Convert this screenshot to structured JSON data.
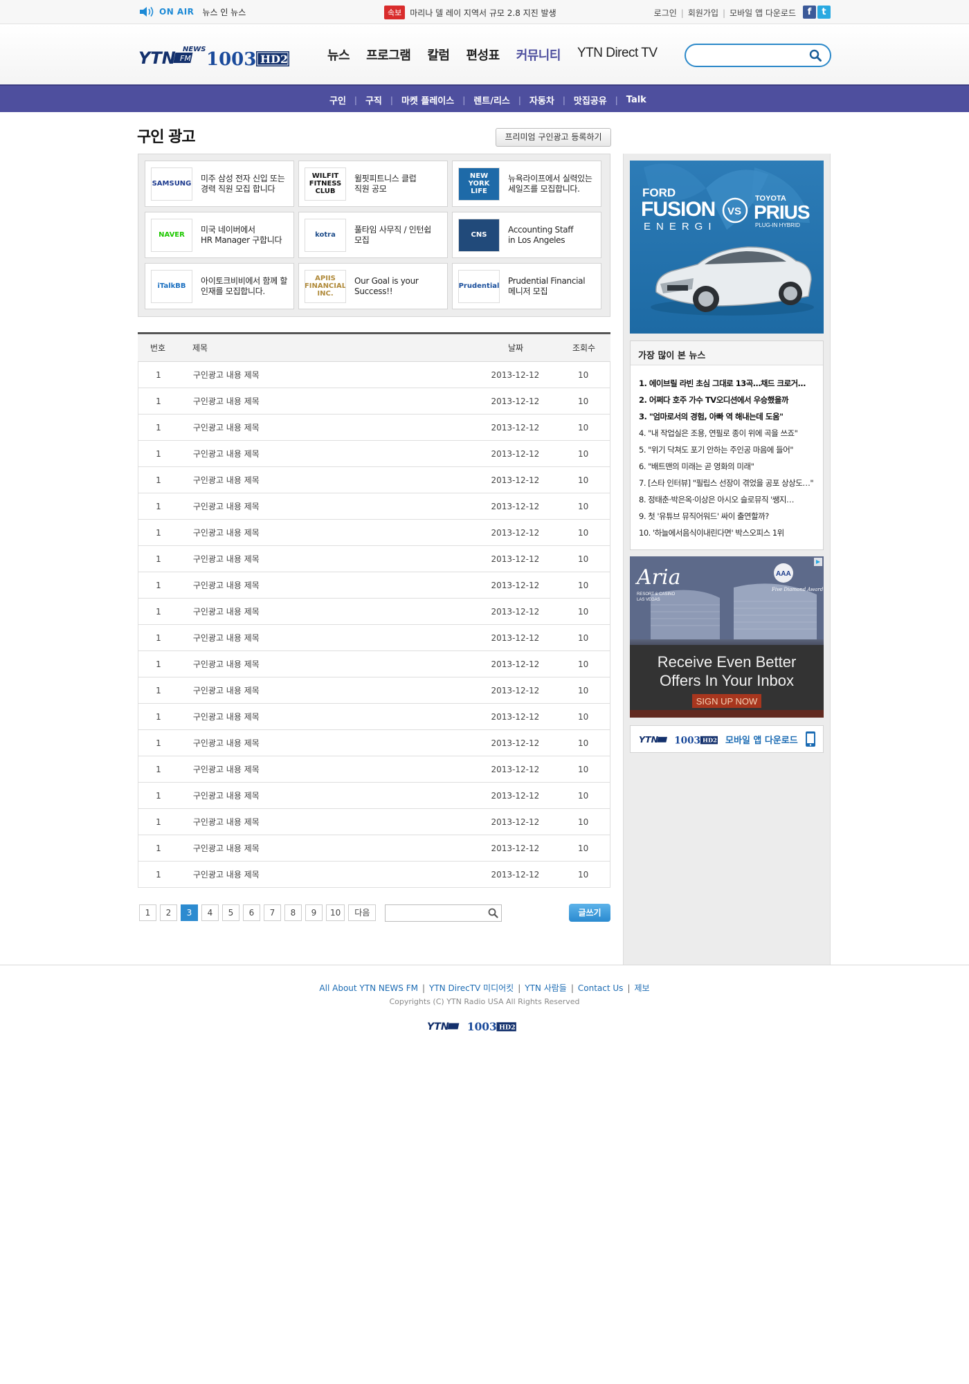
{
  "topbar": {
    "onair_label": "ON AIR",
    "program": "뉴스 인 뉴스",
    "breaking_badge": "속보",
    "breaking_text": "마리나 델 레이 지역서 규모 2.8 지진 발생",
    "login": "로그인",
    "signup": "회원가입",
    "app_download": "모바일 앱 다운로드",
    "sns": [
      {
        "icon": "facebook-icon",
        "glyph": "f",
        "color": "#3b5998"
      },
      {
        "icon": "twitter-icon",
        "glyph": "t",
        "color": "#29a9e1"
      }
    ]
  },
  "brand": {
    "logo_ytn": "YTN",
    "logo_news": "NEWS",
    "logo_fm": "FM",
    "logo_freq": "1003",
    "logo_hd": "HD2"
  },
  "nav": {
    "items": [
      "뉴스",
      "프로그램",
      "칼럼",
      "편성표",
      "커뮤니티",
      "YTN Direct TV"
    ],
    "active_index": 4,
    "search_placeholder": ""
  },
  "subnav": {
    "items": [
      "구인",
      "구직",
      "마켓 플레이스",
      "렌트/리스",
      "자동차",
      "맛집공유",
      "Talk"
    ]
  },
  "page": {
    "title": "구인 광고",
    "premium_button": "프리미엄 구인광고 등록하기"
  },
  "featured": [
    {
      "logo": "SAMSUNG",
      "logo_color": "#1d3b8f",
      "logo_bg": "#fff",
      "text": "미주 삼성 전자 신입 또는\n경력 직원 모집 합니다"
    },
    {
      "logo": "WILFIT FITNESS CLUB",
      "logo_color": "#111",
      "logo_bg": "#fff",
      "text": "윌핏피트니스 클럽\n직원 공모"
    },
    {
      "logo": "NEW YORK LIFE",
      "logo_color": "#fff",
      "logo_bg": "#1e6aa8",
      "text": "뉴욕라이프에서 실력있는\n세일즈를 모집합니다."
    },
    {
      "logo": "NAVER",
      "logo_color": "#1ec800",
      "logo_bg": "#fff",
      "text": "미국 네이버에서\nHR Manager 구합니다"
    },
    {
      "logo": "kotra",
      "logo_color": "#1d4c8a",
      "logo_bg": "#fff",
      "text": "풀타임 사무직 / 인턴쉽\n모집"
    },
    {
      "logo": "CNS",
      "logo_color": "#fff",
      "logo_bg": "#214a7a",
      "text": "Accounting Staff\nin Los Angeles"
    },
    {
      "logo": "iTalkBB",
      "logo_color": "#1a6fc0",
      "logo_bg": "#fff",
      "text": "아이토크비비에서 함께 할\n인재를 모집합니다."
    },
    {
      "logo": "APIIS FINANCIAL INC.",
      "logo_color": "#b08a3a",
      "logo_bg": "#fff",
      "text": "Our Goal is your\nSuccess!!"
    },
    {
      "logo": "Prudential",
      "logo_color": "#1a4f9c",
      "logo_bg": "#fff",
      "text": "Prudential Financial\n메니저 모집"
    }
  ],
  "table": {
    "headers": {
      "no": "번호",
      "title": "제목",
      "date": "날짜",
      "views": "조회수"
    },
    "rows": [
      {
        "no": "1",
        "title": "구인광고 내용 제목",
        "date": "2013-12-12",
        "views": "10"
      },
      {
        "no": "1",
        "title": "구인광고 내용 제목",
        "date": "2013-12-12",
        "views": "10"
      },
      {
        "no": "1",
        "title": "구인광고 내용 제목",
        "date": "2013-12-12",
        "views": "10"
      },
      {
        "no": "1",
        "title": "구인광고 내용 제목",
        "date": "2013-12-12",
        "views": "10"
      },
      {
        "no": "1",
        "title": "구인광고 내용 제목",
        "date": "2013-12-12",
        "views": "10"
      },
      {
        "no": "1",
        "title": "구인광고 내용 제목",
        "date": "2013-12-12",
        "views": "10"
      },
      {
        "no": "1",
        "title": "구인광고 내용 제목",
        "date": "2013-12-12",
        "views": "10"
      },
      {
        "no": "1",
        "title": "구인광고 내용 제목",
        "date": "2013-12-12",
        "views": "10"
      },
      {
        "no": "1",
        "title": "구인광고 내용 제목",
        "date": "2013-12-12",
        "views": "10"
      },
      {
        "no": "1",
        "title": "구인광고 내용 제목",
        "date": "2013-12-12",
        "views": "10"
      },
      {
        "no": "1",
        "title": "구인광고 내용 제목",
        "date": "2013-12-12",
        "views": "10"
      },
      {
        "no": "1",
        "title": "구인광고 내용 제목",
        "date": "2013-12-12",
        "views": "10"
      },
      {
        "no": "1",
        "title": "구인광고 내용 제목",
        "date": "2013-12-12",
        "views": "10"
      },
      {
        "no": "1",
        "title": "구인광고 내용 제목",
        "date": "2013-12-12",
        "views": "10"
      },
      {
        "no": "1",
        "title": "구인광고 내용 제목",
        "date": "2013-12-12",
        "views": "10"
      },
      {
        "no": "1",
        "title": "구인광고 내용 제목",
        "date": "2013-12-12",
        "views": "10"
      },
      {
        "no": "1",
        "title": "구인광고 내용 제목",
        "date": "2013-12-12",
        "views": "10"
      },
      {
        "no": "1",
        "title": "구인광고 내용 제목",
        "date": "2013-12-12",
        "views": "10"
      },
      {
        "no": "1",
        "title": "구인광고 내용 제목",
        "date": "2013-12-12",
        "views": "10"
      },
      {
        "no": "1",
        "title": "구인광고 내용 제목",
        "date": "2013-12-12",
        "views": "10"
      }
    ]
  },
  "pager": {
    "pages": [
      "1",
      "2",
      "3",
      "4",
      "5",
      "6",
      "7",
      "8",
      "9",
      "10"
    ],
    "current": "3",
    "next_label": "다음",
    "search_placeholder": "",
    "write_button": "글쓰기"
  },
  "ads": {
    "ford": {
      "brand_left_top": "FORD",
      "brand_left": "FUSION",
      "brand_left_sub": "ENERGI",
      "vs": "VS",
      "brand_right_top": "TOYOTA",
      "brand_right": "PRIUS",
      "brand_right_sub": "PLUG-IN HYBRID"
    },
    "aria": {
      "logo": "Aria",
      "sub": "RESORT & CASINO\nLAS VEGAS",
      "award": "AAA",
      "award_sub": "Five Diamond Award",
      "headline_1": "Receive Even Better",
      "headline_2": "Offers In Your Inbox",
      "cta": "SIGN UP NOW"
    },
    "mobile_app_label": "모바일 앱 다운로드"
  },
  "popular": {
    "title": "가장 많이 본 뉴스",
    "items": [
      "1. 에이브릴 라빈 초심 그대로 13곡…채드 크로거…",
      "2. 어쩌다 호주 가수 TV오디션에서 우승했을까",
      "3. \"엄마로서의 경험, 아빠 역 해내는데 도움\"",
      "4. \"내 작업실은 조용, 연필로 종이 위에 곡을 쓰죠\"",
      "5. \"위기 닥쳐도 포기 안하는 주인공 마음에 들어\"",
      "6. \"배트맨의 미래는 곧 영화의 미래\"",
      "7. [스타 인터뷰] \"필립스 선장이 겪었을 공포 상상도…\"",
      "8. 정태춘·박은옥·이상은 아시오 슬로뮤직 '쌩지…",
      "9. 첫 '유튜브 뮤직어워드' 싸이 출연할까?",
      "10. '하늘에서음식이내린다면' 박스오피스 1위"
    ],
    "bold_count": 3
  },
  "footer": {
    "links": [
      "All About YTN NEWS FM",
      "YTN DirecTV 미디어킷",
      "YTN 사람들",
      "Contact Us",
      "제보"
    ],
    "copyright": "Copyrights (C) YTN Radio USA All Rights Reserved"
  },
  "colors": {
    "brand_blue": "#1d8ad6",
    "nav_purple": "#4e4f9e",
    "breaking_red": "#d92c2c",
    "pager_active": "#2c8bd0"
  }
}
